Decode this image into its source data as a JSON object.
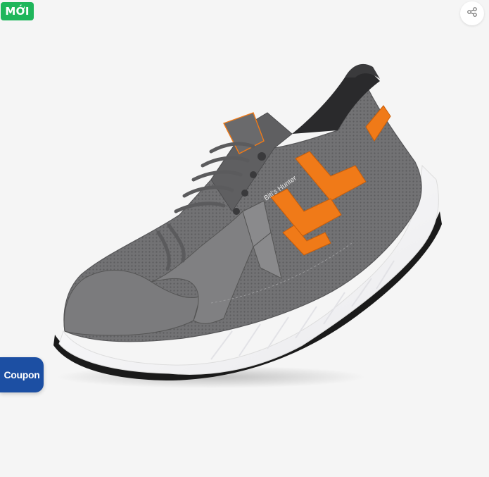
{
  "badge": {
    "label": "MỚI",
    "color": "#1fb65b"
  },
  "share": {
    "icon": "share-icon"
  },
  "coupon": {
    "label": "Coupon",
    "color": "#1c4fa3"
  },
  "product": {
    "brand_text": "Biti's Hunter",
    "colors": {
      "upper": "#6e6e70",
      "accent": "#f07a18",
      "sole": "#ffffff",
      "outsole": "#1a1a1a"
    }
  }
}
